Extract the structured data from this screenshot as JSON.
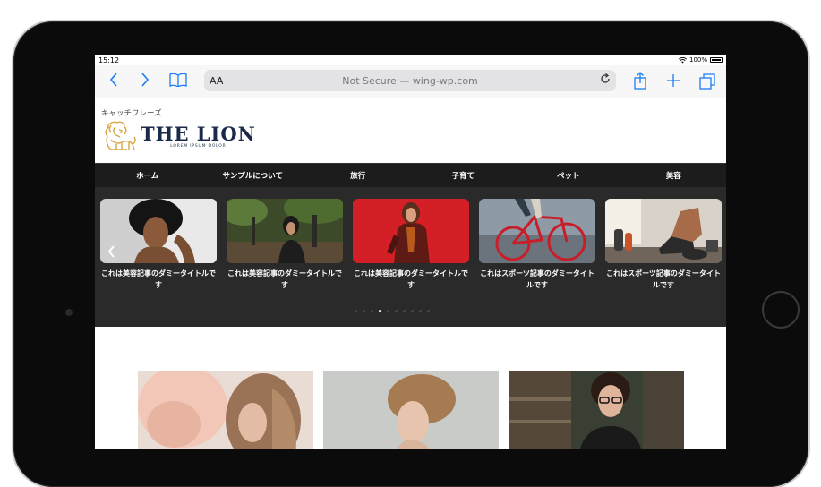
{
  "status": {
    "time": "15:12",
    "battery": "100%"
  },
  "browser": {
    "text_size_button": "AA",
    "address": "Not Secure — wing-wp.com"
  },
  "site": {
    "catchphrase": "キャッチフレーズ",
    "logo": {
      "title": "THE LION",
      "subtitle": "LOREM IPSUM DOLOR"
    }
  },
  "nav": [
    "ホーム",
    "サンプルについて",
    "旅行",
    "子育て",
    "ペット",
    "美容"
  ],
  "slides": [
    {
      "title": "これは美容記事のダミータイトルです",
      "image": "woman-curly-hair-portrait"
    },
    {
      "title": "これは美容記事のダミータイトルです",
      "image": "woman-in-forest"
    },
    {
      "title": "これは美容記事のダミータイトルです",
      "image": "woman-red-jacket-red-background"
    },
    {
      "title": "これはスポーツ記事のダミータイトルです",
      "image": "red-bicycle"
    },
    {
      "title": "これはスポーツ記事のダミータイトルです",
      "image": "gym-shoes-dumbbells"
    }
  ],
  "slider_dots": {
    "count": 10,
    "active": 3
  },
  "cards": [
    {
      "image": "woman-wavy-hair-flowers"
    },
    {
      "image": "woman-updo-profile"
    },
    {
      "image": "woman-glasses-cafe"
    }
  ],
  "colors": {
    "nav_bg": "#1c1c1c",
    "slider_bg": "#2a2a2a",
    "browser_accent": "#1b7cf6",
    "logo_gold": "#d9a441",
    "logo_navy": "#1b2a4a"
  }
}
